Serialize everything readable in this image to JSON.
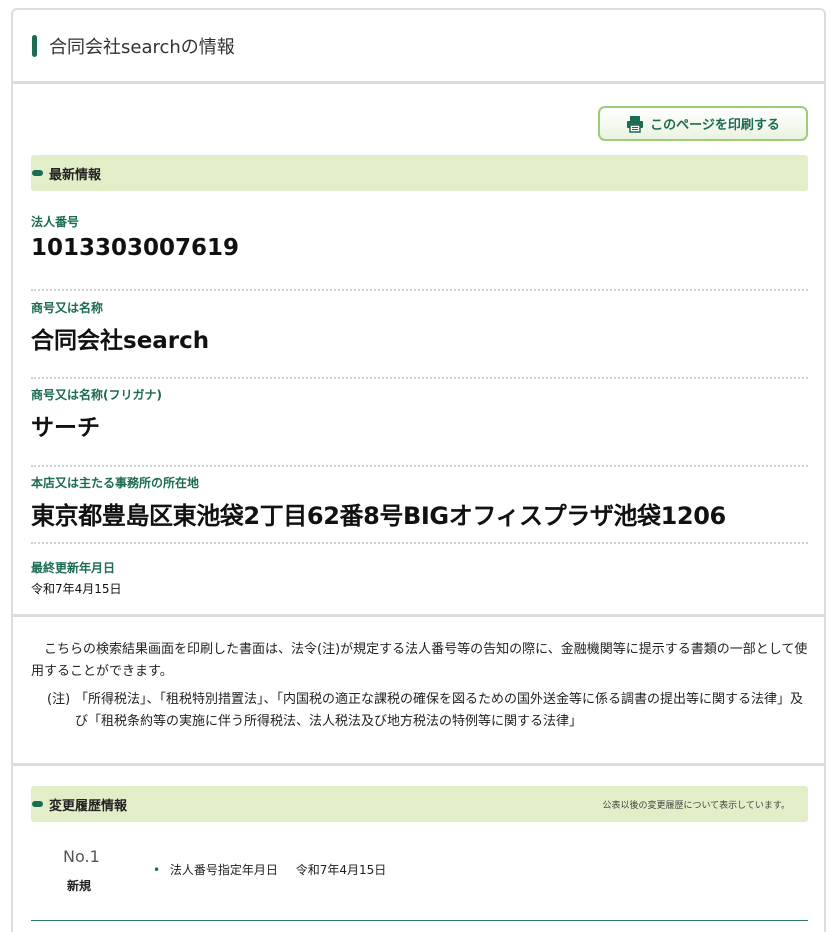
{
  "page": {
    "title": "合同会社searchの情報"
  },
  "toolbar": {
    "print_label": "このページを印刷する",
    "print_icon": "printer-icon"
  },
  "latest": {
    "heading": "最新情報",
    "corporate_number_label": "法人番号",
    "corporate_number": "1013303007619",
    "name_label": "商号又は名称",
    "name": "合同会社search",
    "furigana_label": "商号又は名称(フリガナ)",
    "furigana": "サーチ",
    "address_label": "本店又は主たる事務所の所在地",
    "address": "東京都豊島区東池袋2丁目62番8号BIGオフィスプラザ池袋1206",
    "updated_label": "最終更新年月日",
    "updated": "令和7年4月15日"
  },
  "notice": {
    "main": "こちらの検索結果画面を印刷した書面は、法令(注)が規定する法人番号等の告知の際に、金融機関等に提示する書類の一部として使用することができます。",
    "note_mark": "(注)",
    "note_text": "「所得税法」、「租税特別措置法」、「内国税の適正な課税の確保を図るための国外送金等に係る調書の提出等に関する法律」及び「租税条約等の実施に伴う所得税法、法人税法及び地方税法の特例等に関する法律」"
  },
  "history": {
    "heading": "変更履歴情報",
    "note": "公表以後の変更履歴について表示しています。",
    "entries": [
      {
        "no": "No.1",
        "kind": "新規",
        "label": "法人番号指定年月日",
        "date": "令和7年4月15日"
      }
    ]
  },
  "colors": {
    "accent": "#1c6b54",
    "section_bg": "#e2eec7",
    "button_border": "#9ccc7c",
    "divider": "#dcdcdc"
  }
}
